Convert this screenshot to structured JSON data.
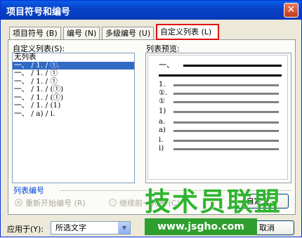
{
  "window": {
    "title": "项目符号和编号",
    "close_glyph": "✕"
  },
  "tabs": [
    {
      "label": "项目符号 (B)"
    },
    {
      "label": "编号 (N)"
    },
    {
      "label": "多级编号 (U)"
    },
    {
      "label": "自定义列表 (L)"
    }
  ],
  "custom_list": {
    "label": "自定义列表(S):",
    "items": [
      "无列表",
      "一、 / 1. / ①.",
      "一、 / 1. / ①",
      "一、 / 1. / ①",
      "一、 / 1. / (①)",
      "一、 / 1. / (①)",
      "一、 / 1. / (1)",
      "一、 / a) / i."
    ],
    "selected_index": 1
  },
  "preview": {
    "label": "列表预览:",
    "rows": [
      "一、",
      "",
      "1.",
      "①.",
      "①",
      "1)",
      "a.",
      "a)",
      "i.",
      "i)"
    ]
  },
  "numbering": {
    "group_label": "列表编号",
    "restart_label": "重新开始编号 (R)",
    "continue_label": "继续前一列表 (C)",
    "restart_checked": true
  },
  "buttons": {
    "customize": "自定义...",
    "cancel": "取消"
  },
  "apply_to": {
    "label": "应用于(Y):",
    "value": "所选文字"
  },
  "watermark": {
    "text": "技术员联盟",
    "url": "www.jsgho.com"
  },
  "colors": {
    "accent": "#316ac5",
    "tab_highlight": "#e01010",
    "watermark": "#2fb52f"
  }
}
